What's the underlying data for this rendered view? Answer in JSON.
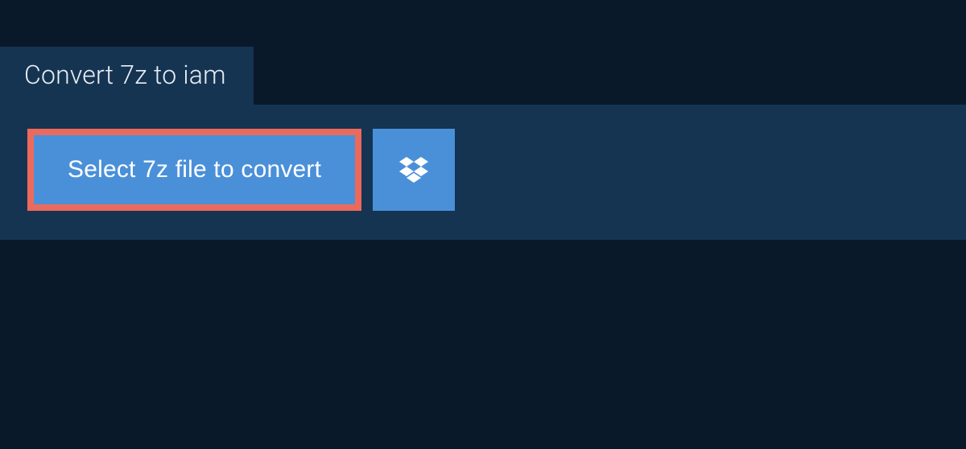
{
  "tab": {
    "title": "Convert 7z to iam"
  },
  "actions": {
    "select_file_label": "Select 7z file to convert"
  },
  "colors": {
    "background": "#0a1929",
    "panel": "#153452",
    "button": "#4a90d9",
    "highlight_border": "#ec6a5c",
    "text_light": "#e8eef4"
  }
}
